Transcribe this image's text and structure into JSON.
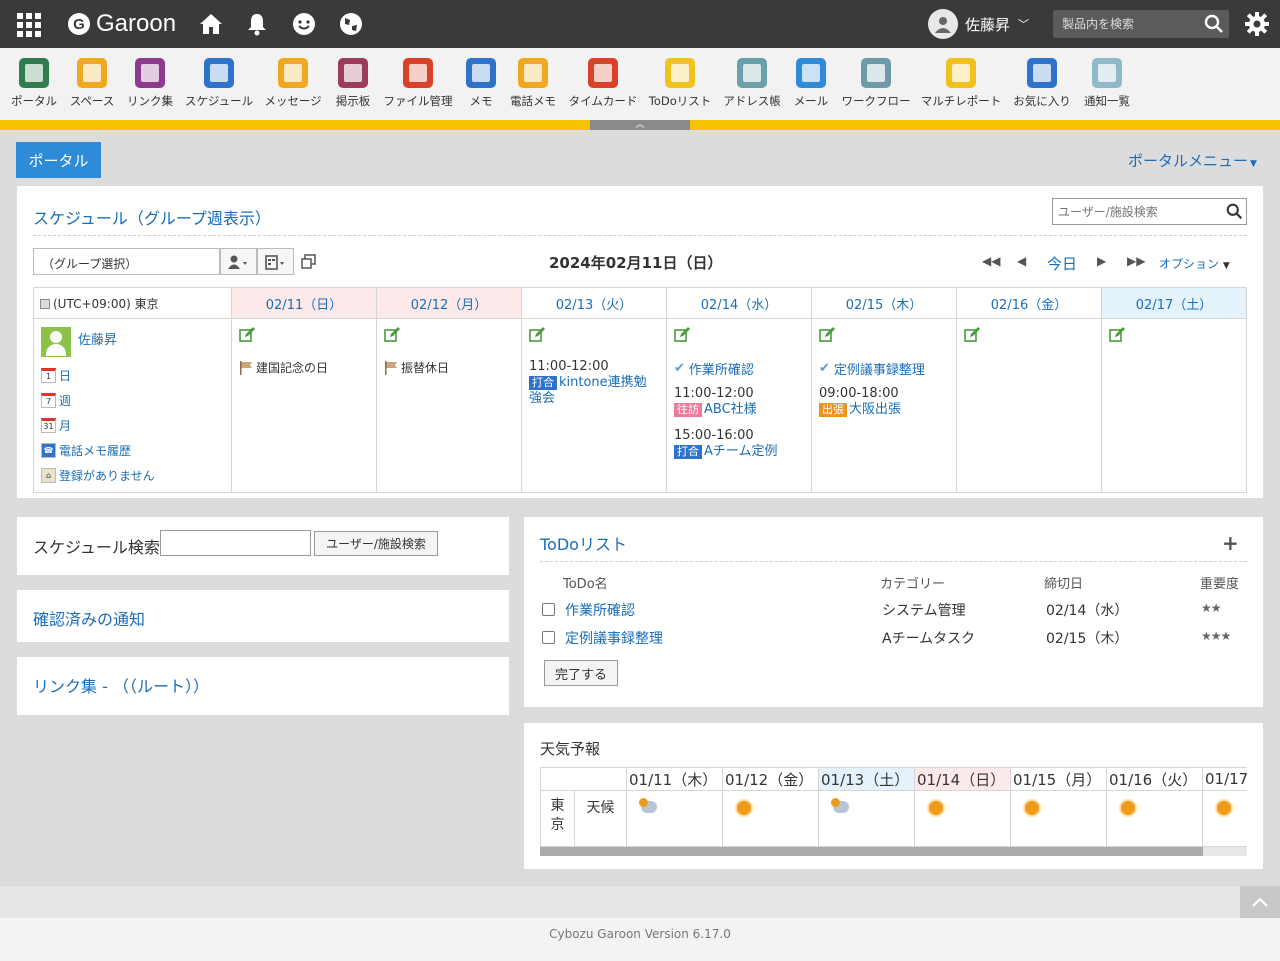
{
  "topbar": {
    "logo": "Garoon",
    "user_name": "佐藤昇",
    "search_placeholder": "製品内を検索"
  },
  "apps": [
    {
      "label": "ポータル",
      "color": "#2f7d4e"
    },
    {
      "label": "スペース",
      "color": "#f0a81e"
    },
    {
      "label": "リンク集",
      "color": "#8e3a8e"
    },
    {
      "label": "スケジュール",
      "color": "#2e73c9"
    },
    {
      "label": "メッセージ",
      "color": "#f0a81e"
    },
    {
      "label": "掲示板",
      "color": "#9c3b5c"
    },
    {
      "label": "ファイル管理",
      "color": "#d9412a"
    },
    {
      "label": "メモ",
      "color": "#2e73c9"
    },
    {
      "label": "電話メモ",
      "color": "#f0a81e"
    },
    {
      "label": "タイムカード",
      "color": "#d9412a"
    },
    {
      "label": "ToDoリスト",
      "color": "#f0c21e"
    },
    {
      "label": "アドレス帳",
      "color": "#6aa0a8"
    },
    {
      "label": "メール",
      "color": "#2e8bd8"
    },
    {
      "label": "ワークフロー",
      "color": "#6e9aa8"
    },
    {
      "label": "マルチレポート",
      "color": "#f0c21e"
    },
    {
      "label": "お気に入り",
      "color": "#2e73c9"
    },
    {
      "label": "通知一覧",
      "color": "#8fb8c8"
    }
  ],
  "portal": {
    "tab": "ポータル",
    "menu": "ポータルメニュー"
  },
  "schedule": {
    "title": "スケジュール（グループ週表示）",
    "facility_placeholder": "ユーザー/施設検索",
    "group_select": "（グループ選択）",
    "date_title": "2024年02月11日（日）",
    "today": "今日",
    "option": "オプション",
    "timezone": "(UTC+09:00) 東京",
    "days": [
      "02/11（日）",
      "02/12（月）",
      "02/13（火）",
      "02/14（水）",
      "02/15（木）",
      "02/16（金）",
      "02/17（土）"
    ],
    "user": {
      "name": "佐藤昇",
      "links": [
        "日",
        "週",
        "月",
        "電話メモ履歴",
        "登録がありません"
      ]
    },
    "holidays": {
      "d0": "建国記念の日",
      "d1": "振替休日"
    },
    "d2": {
      "time": "11:00-12:00",
      "tag": "打合",
      "title": "kintone連携勉強会"
    },
    "d3": {
      "task": "作業所確認",
      "e1_time": "11:00-12:00",
      "e1_tag": "往訪",
      "e1_title": "ABC社様",
      "e2_time": "15:00-16:00",
      "e2_tag": "打合",
      "e2_title": "Aチーム定例"
    },
    "d4": {
      "task": "定例議事録整理",
      "e1_time": "09:00-18:00",
      "e1_tag": "出張",
      "e1_title": "大阪出張"
    }
  },
  "schedule_search": {
    "label": "スケジュール検索",
    "button": "ユーザー/施設検索"
  },
  "confirm_title": "確認済みの通知",
  "links_title": "リンク集 - （（ルート））",
  "todo": {
    "title": "ToDoリスト",
    "headers": [
      "ToDo名",
      "カテゴリー",
      "締切日",
      "重要度"
    ],
    "rows": [
      {
        "name": "作業所確認",
        "category": "システム管理",
        "due": "02/14（水）",
        "priority": "★★"
      },
      {
        "name": "定例議事録整理",
        "category": "Aチームタスク",
        "due": "02/15（木）",
        "priority": "★★★"
      }
    ],
    "done_button": "完了する"
  },
  "weather": {
    "title": "天気予報",
    "city": "東京",
    "row_label": "天候",
    "days": [
      "01/11（木）",
      "01/12（金）",
      "01/13（土）",
      "01/14（日）",
      "01/15（月）",
      "01/16（火）",
      "01/17"
    ],
    "conditions": [
      "cloudy-sun",
      "sunny",
      "cloudy-sun",
      "sunny",
      "sunny",
      "sunny",
      "sunny"
    ]
  },
  "footer": "Cybozu Garoon Version 6.17.0"
}
